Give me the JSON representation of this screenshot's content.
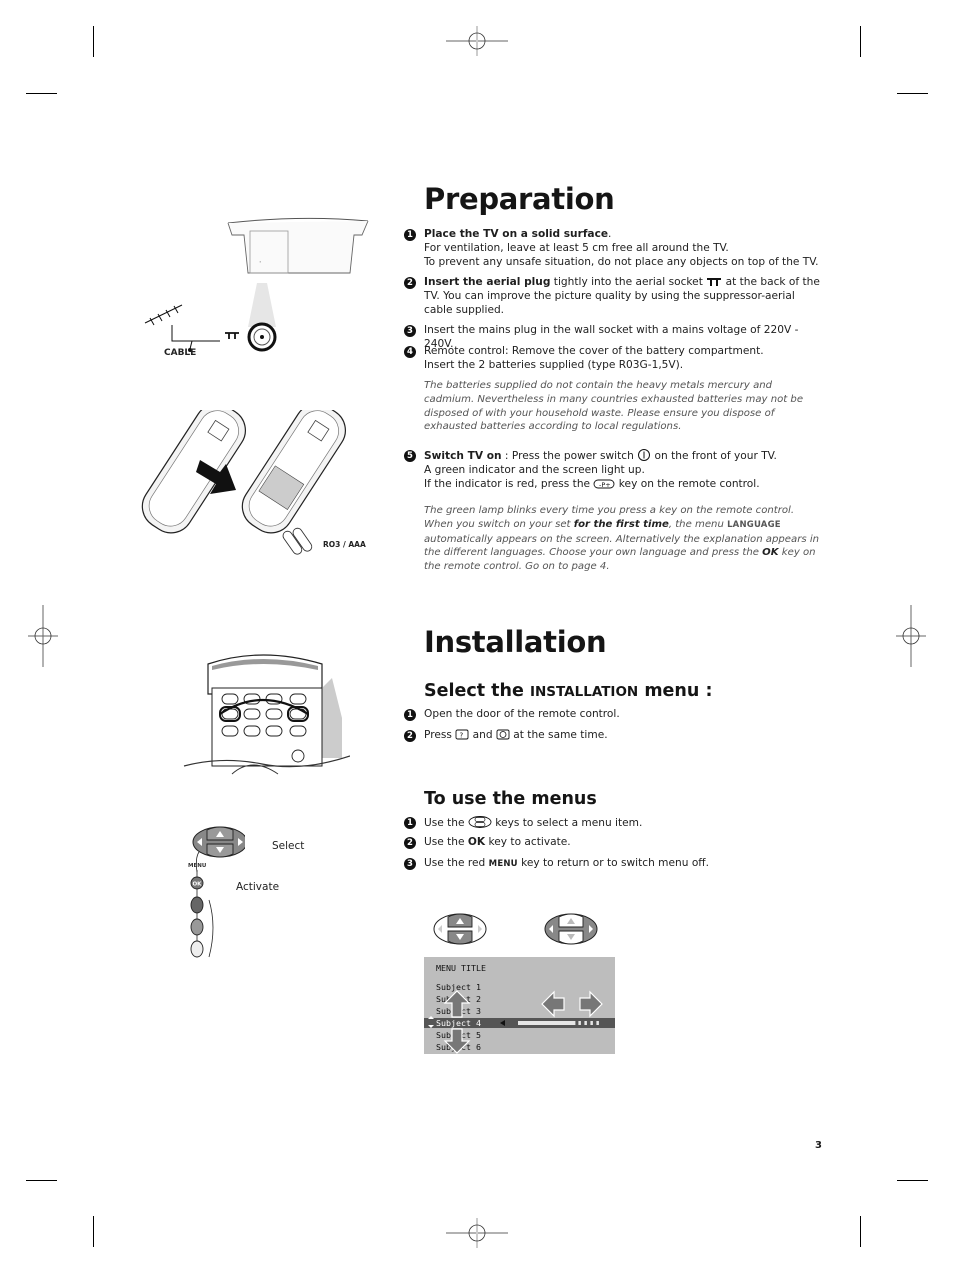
{
  "preparation": {
    "title": "Preparation",
    "steps": [
      {
        "num": "1",
        "bold": "Place the TV on a solid surface",
        "after_bold": ".",
        "lines": [
          "For ventilation, leave at least 5 cm free all around the TV.",
          "To prevent any unsafe situation, do not place any objects on top of the TV."
        ]
      },
      {
        "num": "2",
        "bold": "Insert the aerial plug",
        "text_a": " tightly into the aerial socket ",
        "icon": "aerial-socket-icon",
        "text_b": " at  the back of the TV. You can improve the picture quality by using the suppressor-aerial cable supplied."
      },
      {
        "num": "3",
        "text": "Insert the mains plug in the wall socket with a mains voltage of 220V - 240V."
      },
      {
        "num": "4",
        "lines": [
          "Remote control: Remove the cover of the battery compartment.",
          "Insert the 2 batteries supplied (type R03G-1,5V)."
        ]
      },
      {
        "num": "5",
        "bold": "Switch TV on",
        "text_a": " : Press the power switch ",
        "icon": "power-switch-icon",
        "text_b": " on the front of your TV.",
        "line2": "A green indicator and the screen light up.",
        "line3_a": "If the indicator is red, press the ",
        "line3_icon": "program-key-icon",
        "line3_b": " key on the remote control."
      }
    ],
    "battery_note": "The batteries supplied do not contain the heavy metals mercury and cadmium. Nevertheless in many countries exhausted batteries may not be disposed of with your household waste. Please ensure you dispose of exhausted batteries according to local regulations.",
    "switch_note": {
      "line1": "The green lamp blinks every time you press a key on the remote control.",
      "part_a": "When you switch on your set ",
      "bold_a": "for the first time",
      "part_b": ", the menu ",
      "menu_name": "LANGUAGE",
      "part_c": " automatically appears on the screen. Alternatively the explanation appears in the different languages. Choose your own language and press the ",
      "bold_b": "OK",
      "part_d": " key on the remote control. Go on to page 4."
    },
    "figure_labels": {
      "cable": "CABLE",
      "battery_type": "RO3 / AAA"
    }
  },
  "installation": {
    "title": "Installation",
    "select_heading_a": "Select the ",
    "select_heading_sc": "INSTALLATION",
    "select_heading_b": " menu :",
    "select_steps": [
      {
        "num": "1",
        "text": "Open the door of the remote control."
      },
      {
        "num": "2",
        "text_a": "Press ",
        "key1": "?",
        "text_b": " and ",
        "key2": "clock",
        "text_c": " at the same time."
      }
    ],
    "use_heading": "To use the menus",
    "use_steps": [
      {
        "num": "1",
        "text_a": "Use the ",
        "icon": "cursor-keys-icon",
        "text_b": " keys to select a menu item."
      },
      {
        "num": "2",
        "text_a": "Use the ",
        "bold": "OK",
        "text_b": " key to activate."
      },
      {
        "num": "3",
        "text_a": "Use the red ",
        "sc": "MENU",
        "text_b": " key to return or to switch menu off."
      }
    ],
    "remote_labels": {
      "select": "Select",
      "activate": "Activate",
      "menu": "MENU",
      "ok": "OK"
    },
    "menu_screen": {
      "title": "MENU TITLE",
      "items": [
        "Subject 1",
        "Subject 2",
        "Subject 3",
        "Subject 4",
        "Subject 5",
        "Subject 6"
      ],
      "selected_index": 3,
      "slider_fill_fraction": 0.7
    }
  },
  "page_number": "3"
}
